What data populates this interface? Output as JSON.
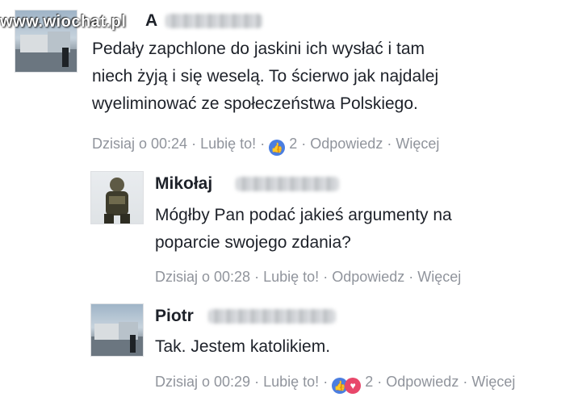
{
  "watermark": "www.wiochat.pl",
  "comments": [
    {
      "author": "A",
      "text_lines": [
        "Pedały zapchlone do jaskini ich wysłać i tam",
        "niech żyją i się weselą. To ścierwo jak najdalej",
        "wyeliminować ze społeczeństwa Polskiego."
      ],
      "time": "Dzisiaj o 00:24",
      "like": "Lubię to!",
      "reactions_count": "2",
      "reply": "Odpowiedz",
      "more": "Więcej"
    },
    {
      "author": "Mikołaj",
      "text_lines": [
        "Mógłby Pan podać jakieś argumenty na",
        "poparcie swojego zdania?"
      ],
      "time": "Dzisiaj o 00:28",
      "like": "Lubię to!",
      "reply": "Odpowiedz",
      "more": "Więcej"
    },
    {
      "author": "Piotr",
      "text_lines": [
        "Tak. Jestem katolikiem."
      ],
      "time": "Dzisiaj o 00:29",
      "like": "Lubię to!",
      "reactions_count": "2",
      "reply": "Odpowiedz",
      "more": "Więcej"
    }
  ],
  "separator": "·",
  "icons": {
    "like": "thumbs-up-icon",
    "love": "heart-icon"
  },
  "colors": {
    "meta": "#90949c",
    "like_blue": "#4b7ee0",
    "love_red": "#e8476a"
  }
}
